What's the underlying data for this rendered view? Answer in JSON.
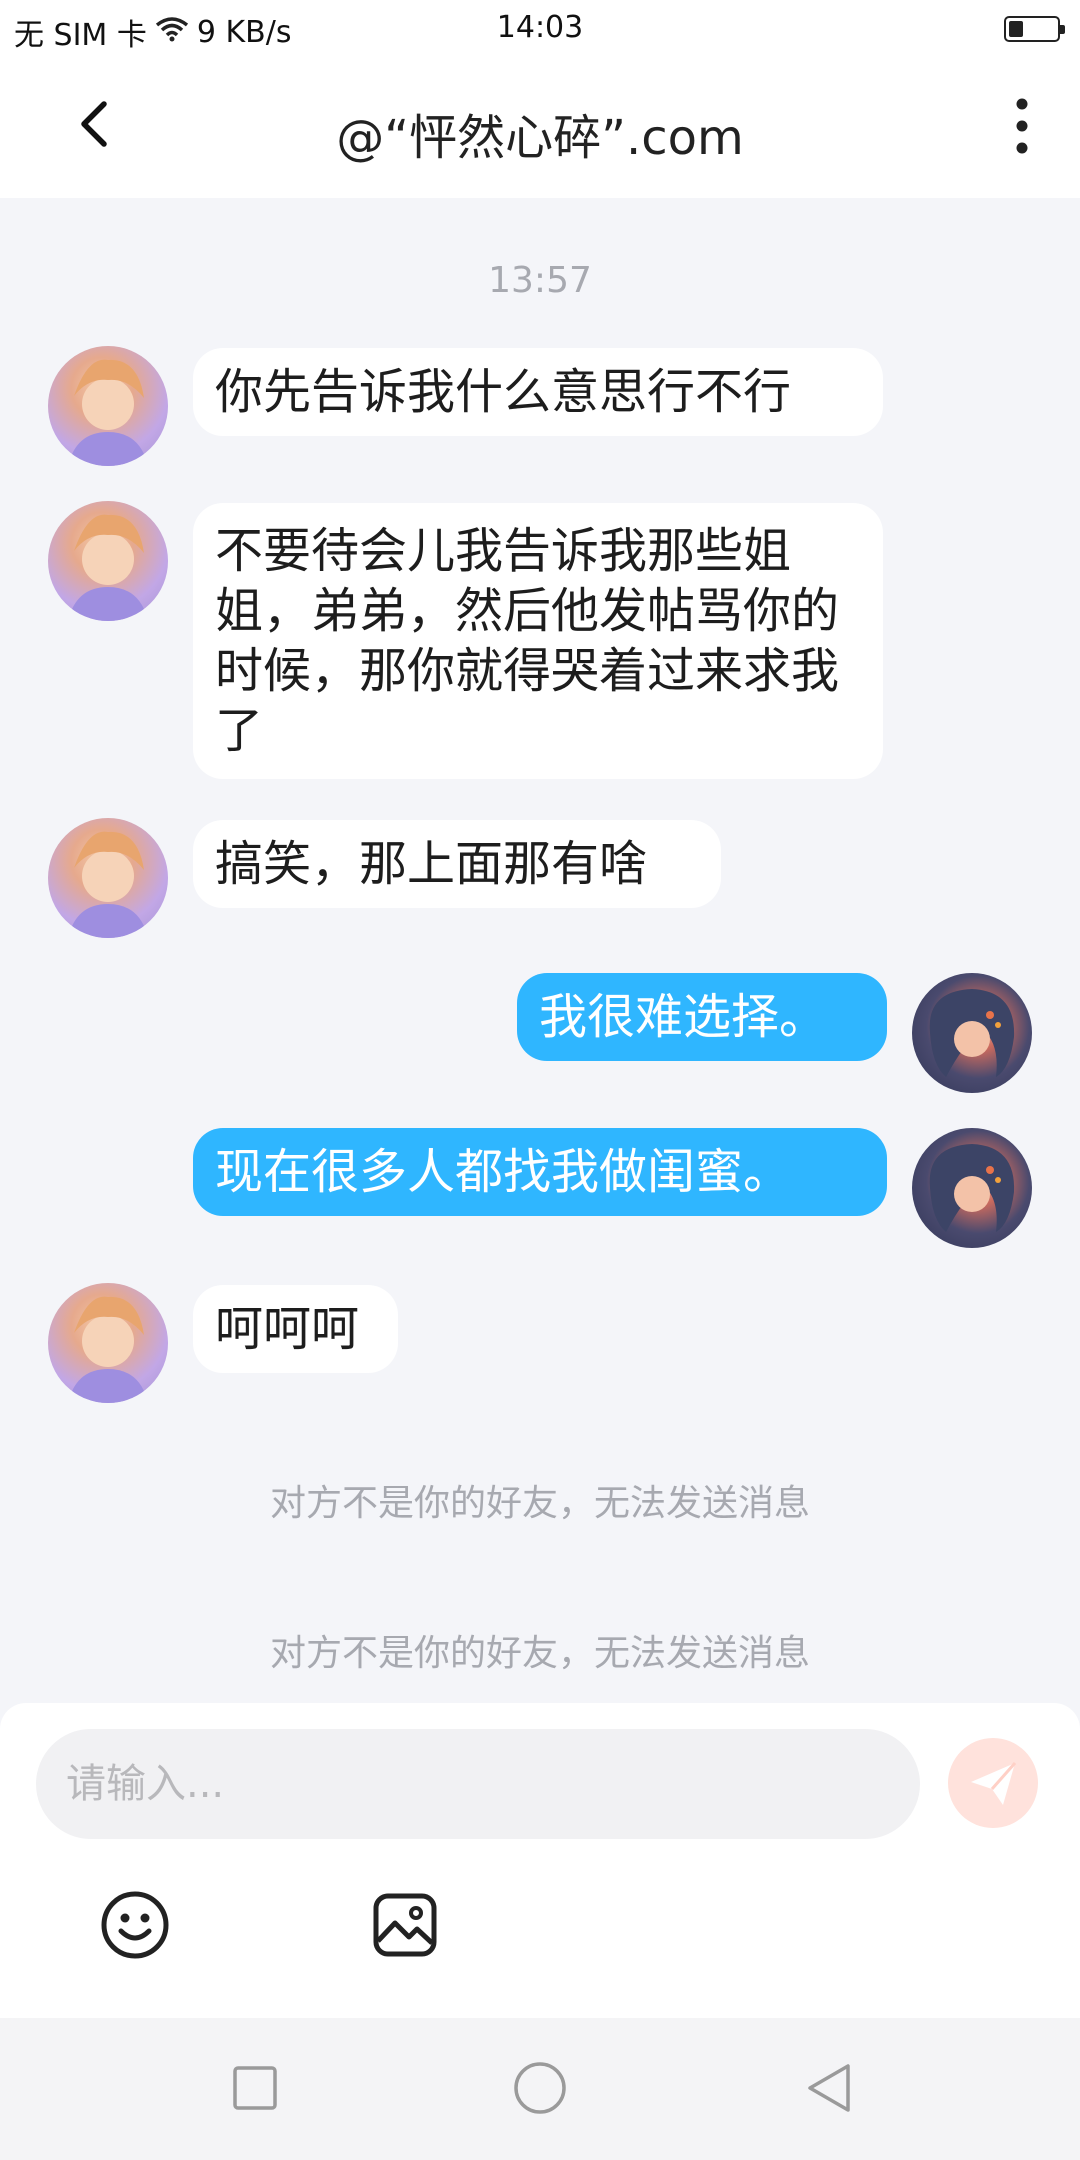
{
  "status_bar": {
    "carrier": "无 SIM 卡",
    "network_speed": "9 KB/s",
    "time": "14:03",
    "battery_level": 0.3
  },
  "header": {
    "title": "@“怦然心碎”.com",
    "back_icon": "chevron-left-icon",
    "more_icon": "more-vertical-icon"
  },
  "chat": {
    "timestamp": "13:57",
    "messages": [
      {
        "sender": "other",
        "text": "你先告诉我什么意思行不行"
      },
      {
        "sender": "other",
        "text": "不要待会儿我告诉我那些姐姐，弟弟，然后他发帖骂你的时候，那你就得哭着过来求我了"
      },
      {
        "sender": "other",
        "text": "搞笑，那上面那有啥"
      },
      {
        "sender": "me",
        "text": "我很难选择。"
      },
      {
        "sender": "me",
        "text": "现在很多人都找我做闺蜜。"
      },
      {
        "sender": "other",
        "text": "呵呵呵"
      }
    ],
    "notices": [
      "对方不是你的好友，无法发送消息",
      "对方不是你的好友，无法发送消息"
    ]
  },
  "input": {
    "placeholder": "请输入...",
    "value": "",
    "send_icon": "send-icon",
    "emoji_icon": "emoji-icon",
    "image_icon": "image-icon"
  },
  "nav": {
    "recents_icon": "square-icon",
    "home_icon": "circle-icon",
    "back_icon": "triangle-back-icon"
  },
  "colors": {
    "outgoing_bubble": "#2fb6ff",
    "background": "#f4f5f9",
    "notice_text": "#a7a9b0"
  }
}
